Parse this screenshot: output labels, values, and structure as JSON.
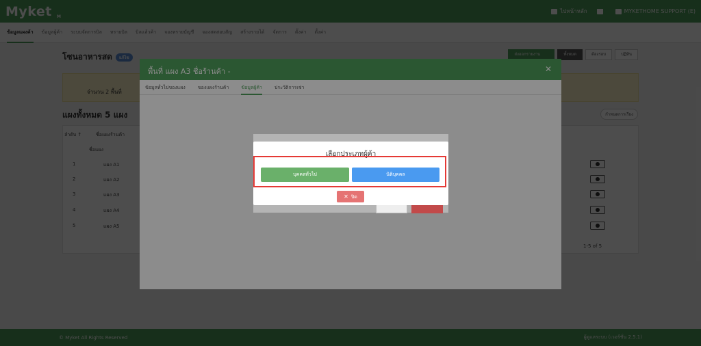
{
  "header": {
    "logo": "Myket",
    "logo_suffix": "M",
    "link1": "ไปหน้าหลัก",
    "user": "MYKETHOME SUPPORT (E)"
  },
  "nav": [
    "ข้อมูลแผงค้า",
    "ข้อมูลผู้ค้า",
    "ระบบจัดการบิล",
    "ทรายบิล",
    "บิลแล้วค้า",
    "จองทรายบัญชี",
    "จองสดสอบสัญ",
    "สร้างรายได้",
    "จัดการ",
    "ตั้งค่า",
    "ตั้งค่า"
  ],
  "page": {
    "title": "โซนอาหารสด",
    "badge": "แก้ไข"
  },
  "top_buttons": {
    "green": "ส่งออกรายงาน",
    "b1": "ทั้งหมด",
    "b2": "ต้องรอบ",
    "b3": "ปฏิทิน"
  },
  "banner": {
    "text": "จำนวน 2 พื้นที่"
  },
  "section": {
    "title": "แผงทั้งหมด 5 แผง",
    "sort": "กำหนดการเรียง"
  },
  "table": {
    "headers": {
      "no": "ลำดับ ↑",
      "name": "ชื่อแผงร้านค้า"
    },
    "filter_placeholder": "ชื่อแผง",
    "rows": [
      {
        "no": "1",
        "name": "แผง A1"
      },
      {
        "no": "2",
        "name": "แผง A2"
      },
      {
        "no": "3",
        "name": "แผง A3"
      },
      {
        "no": "4",
        "name": "แผง A4"
      },
      {
        "no": "5",
        "name": "แผง A5"
      }
    ],
    "pager": "1-5 of 5"
  },
  "footer": {
    "left": "© Myket All Rights Reserved",
    "right": "ผู้ดูแลระบบ (เวอร์ชั่น 2.5.1)"
  },
  "modal1": {
    "title": "พื้นที่ แผง A3  ชื่อร้านค้า -",
    "tabs": [
      "ข้อมูลทั่วไปของแผง",
      "ของแผงร้านค้า",
      "ข้อมูลผู้ค้า",
      "ประวัติการเช่า"
    ]
  },
  "modal2": {
    "title": "เลือกประเภทผู้ค้า",
    "btn_person": "บุคคลทั่วไป",
    "btn_company": "นิติบุคคล",
    "btn_close": "ปิด"
  }
}
